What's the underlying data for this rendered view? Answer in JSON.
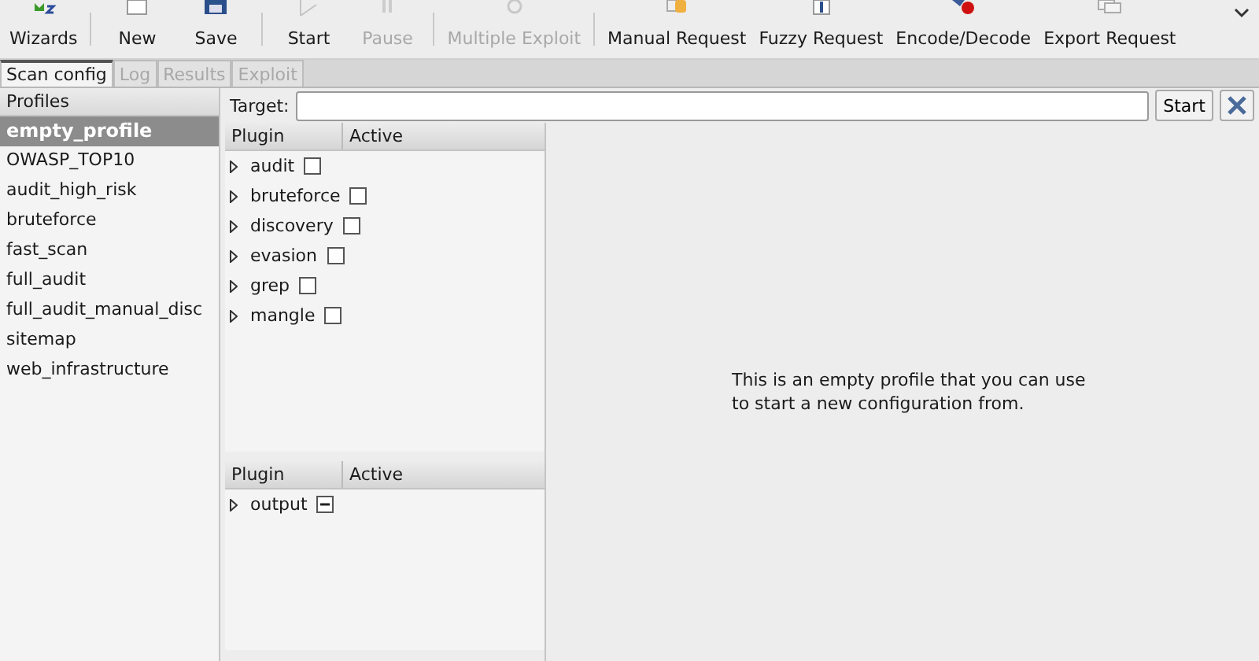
{
  "toolbar": {
    "groups": [
      [
        {
          "label": "Wizards",
          "disabled": false
        }
      ],
      [
        {
          "label": "New",
          "disabled": false
        },
        {
          "label": "Save",
          "disabled": false
        }
      ],
      [
        {
          "label": "Start",
          "disabled": false
        },
        {
          "label": "Pause",
          "disabled": true
        }
      ],
      [
        {
          "label": "Multiple Exploit",
          "disabled": true
        }
      ],
      [
        {
          "label": "Manual Request",
          "disabled": false
        },
        {
          "label": "Fuzzy Request",
          "disabled": false
        },
        {
          "label": "Encode/Decode",
          "disabled": false
        },
        {
          "label": "Export Request",
          "disabled": false
        }
      ]
    ]
  },
  "tabs": [
    {
      "label": "Scan config",
      "selected": true,
      "disabled": false
    },
    {
      "label": "Log",
      "selected": false,
      "disabled": true
    },
    {
      "label": "Results",
      "selected": false,
      "disabled": true
    },
    {
      "label": "Exploit",
      "selected": false,
      "disabled": true
    }
  ],
  "profiles": {
    "header": "Profiles",
    "items": [
      {
        "name": "empty_profile",
        "selected": true
      },
      {
        "name": "OWASP_TOP10",
        "selected": false
      },
      {
        "name": "audit_high_risk",
        "selected": false
      },
      {
        "name": "bruteforce",
        "selected": false
      },
      {
        "name": "fast_scan",
        "selected": false
      },
      {
        "name": "full_audit",
        "selected": false
      },
      {
        "name": "full_audit_manual_disc",
        "selected": false
      },
      {
        "name": "sitemap",
        "selected": false
      },
      {
        "name": "web_infrastructure",
        "selected": false
      }
    ]
  },
  "target": {
    "label": "Target:",
    "button": "Start"
  },
  "plugins": {
    "columns": [
      "Plugin",
      "Active"
    ],
    "rows": [
      {
        "name": "audit",
        "checked": false,
        "partial": false
      },
      {
        "name": "bruteforce",
        "checked": false,
        "partial": false
      },
      {
        "name": "discovery",
        "checked": false,
        "partial": false
      },
      {
        "name": "evasion",
        "checked": false,
        "partial": false
      },
      {
        "name": "grep",
        "checked": false,
        "partial": false
      },
      {
        "name": "mangle",
        "checked": false,
        "partial": false
      }
    ]
  },
  "output_plugins": {
    "columns": [
      "Plugin",
      "Active"
    ],
    "rows": [
      {
        "name": "output",
        "checked": false,
        "partial": true
      }
    ]
  },
  "description": "This is an empty profile that you can use\nto start a new configuration from."
}
